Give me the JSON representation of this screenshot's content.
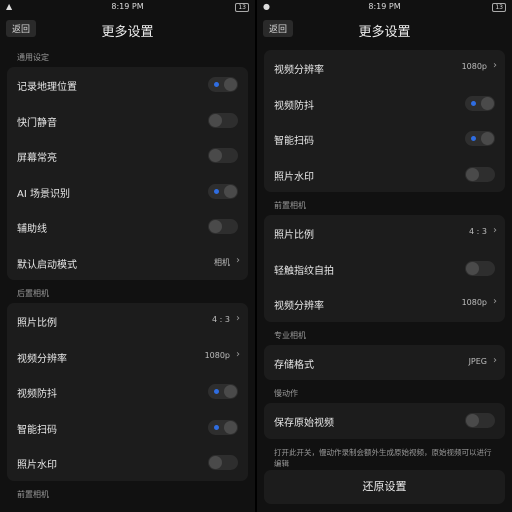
{
  "left": {
    "status": {
      "time": "8:19 PM",
      "battery": "13"
    },
    "nav": {
      "back_label": "返回",
      "title": "更多设置"
    },
    "sections": [
      {
        "header": "通用设定",
        "rows": [
          {
            "label": "记录地理位置",
            "type": "toggle",
            "on": true
          },
          {
            "label": "快门静音",
            "type": "toggle",
            "on": false
          },
          {
            "label": "屏幕常亮",
            "type": "toggle",
            "on": false
          },
          {
            "label": "AI 场景识别",
            "type": "toggle",
            "on": true
          },
          {
            "label": "辅助线",
            "type": "toggle",
            "on": false
          },
          {
            "label": "默认启动模式",
            "type": "value",
            "value": "相机"
          }
        ]
      },
      {
        "header": "后置相机",
        "rows": [
          {
            "label": "照片比例",
            "type": "value",
            "value": "4 : 3"
          },
          {
            "label": "视频分辨率",
            "type": "value",
            "value": "1080p"
          },
          {
            "label": "视频防抖",
            "type": "toggle",
            "on": true
          },
          {
            "label": "智能扫码",
            "type": "toggle",
            "on": true
          },
          {
            "label": "照片水印",
            "type": "toggle",
            "on": false
          }
        ]
      },
      {
        "header": "前置相机",
        "rows": []
      }
    ]
  },
  "right": {
    "status": {
      "time": "8:19 PM",
      "battery": "13"
    },
    "nav": {
      "back_label": "返回",
      "title": "更多设置"
    },
    "sections": [
      {
        "header": "",
        "rows": [
          {
            "label": "视频分辨率",
            "type": "value",
            "value": "1080p"
          },
          {
            "label": "视频防抖",
            "type": "toggle",
            "on": true
          },
          {
            "label": "智能扫码",
            "type": "toggle",
            "on": true
          },
          {
            "label": "照片水印",
            "type": "toggle",
            "on": false
          }
        ]
      },
      {
        "header": "前置相机",
        "rows": [
          {
            "label": "照片比例",
            "type": "value",
            "value": "4 : 3"
          },
          {
            "label": "轻触指纹自拍",
            "type": "toggle",
            "on": false
          },
          {
            "label": "视频分辨率",
            "type": "value",
            "value": "1080p"
          }
        ]
      },
      {
        "header": "专业相机",
        "rows": [
          {
            "label": "存储格式",
            "type": "value",
            "value": "JPEG"
          }
        ]
      },
      {
        "header": "慢动作",
        "rows": [
          {
            "label": "保存原始视频",
            "type": "toggle",
            "on": false
          }
        ]
      }
    ],
    "hint": "打开此开关，慢动作录制会额外生成原始视频，原始视频可以进行编辑",
    "restore_label": "还原设置"
  },
  "colors": {
    "toggle_on_dot": "#2f6de1",
    "card_bg": "#1c1c1c",
    "page_bg": "#111111"
  }
}
